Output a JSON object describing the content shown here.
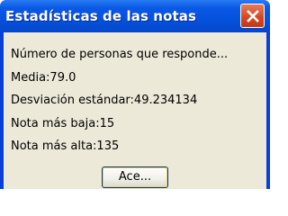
{
  "window": {
    "title": "Estadísticas de las notas",
    "close_icon": "close-icon"
  },
  "stats": {
    "respondents": "Número de personas que responde...",
    "mean": "Media:79.0",
    "std_dev": "Desviación estándar:49.234134",
    "min": "Nota más baja:15",
    "max": "Nota más alta:135"
  },
  "buttons": {
    "ok_label": "Ace..."
  },
  "colors": {
    "titlebar": "#0552de",
    "close_button": "#d5451f",
    "client_background": "#ece9d8"
  }
}
